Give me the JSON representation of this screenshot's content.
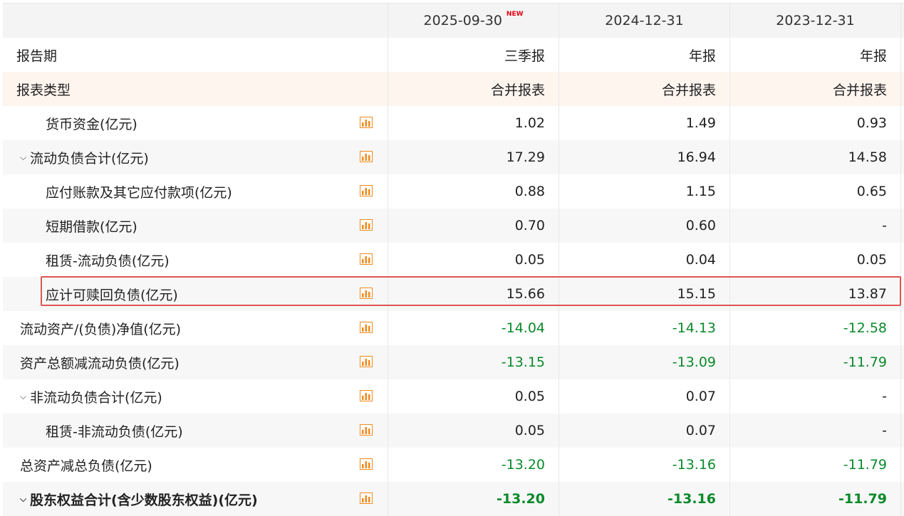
{
  "header": {
    "periods": [
      "2025-09-30",
      "2024-12-31",
      "2023-12-31"
    ],
    "new_badge": "NEW"
  },
  "meta_rows": [
    {
      "label": "报告期",
      "values": [
        "三季报",
        "年报",
        "年报"
      ]
    },
    {
      "label": "报表类型",
      "values": [
        "合并报表",
        "合并报表",
        "合并报表"
      ]
    }
  ],
  "rows": [
    {
      "label": "货币资金(亿元)",
      "values": [
        "1.02",
        "1.49",
        "0.93"
      ]
    },
    {
      "label": "流动负债合计(亿元)",
      "values": [
        "17.29",
        "16.94",
        "14.58"
      ]
    },
    {
      "label": "应付账款及其它应付款项(亿元)",
      "values": [
        "0.88",
        "1.15",
        "0.65"
      ]
    },
    {
      "label": "短期借款(亿元)",
      "values": [
        "0.70",
        "0.60",
        "-"
      ]
    },
    {
      "label": "租赁-流动负债(亿元)",
      "values": [
        "0.05",
        "0.04",
        "0.05"
      ]
    },
    {
      "label": "应计可赎回负债(亿元)",
      "values": [
        "15.66",
        "15.15",
        "13.87"
      ]
    },
    {
      "label": "流动资产/(负债)净值(亿元)",
      "values": [
        "-14.04",
        "-14.13",
        "-12.58"
      ]
    },
    {
      "label": "资产总额减流动负债(亿元)",
      "values": [
        "-13.15",
        "-13.09",
        "-11.79"
      ]
    },
    {
      "label": "非流动负债合计(亿元)",
      "values": [
        "0.05",
        "0.07",
        "-"
      ]
    },
    {
      "label": "租赁-非流动负债(亿元)",
      "values": [
        "0.05",
        "0.07",
        "-"
      ]
    },
    {
      "label": "总资产减总负债(亿元)",
      "values": [
        "-13.20",
        "-13.16",
        "-11.79"
      ]
    },
    {
      "label": "股东权益合计(含少数股东权益)(亿元)",
      "values": [
        "-13.20",
        "-13.16",
        "-11.79"
      ]
    }
  ],
  "colors": {
    "negative": "#0a8a2a",
    "highlight_border": "#e05555",
    "chart_icon": "#f08a1c"
  },
  "icons": {
    "chart": "bar-chart-icon",
    "expand": "chevron-down-icon"
  }
}
